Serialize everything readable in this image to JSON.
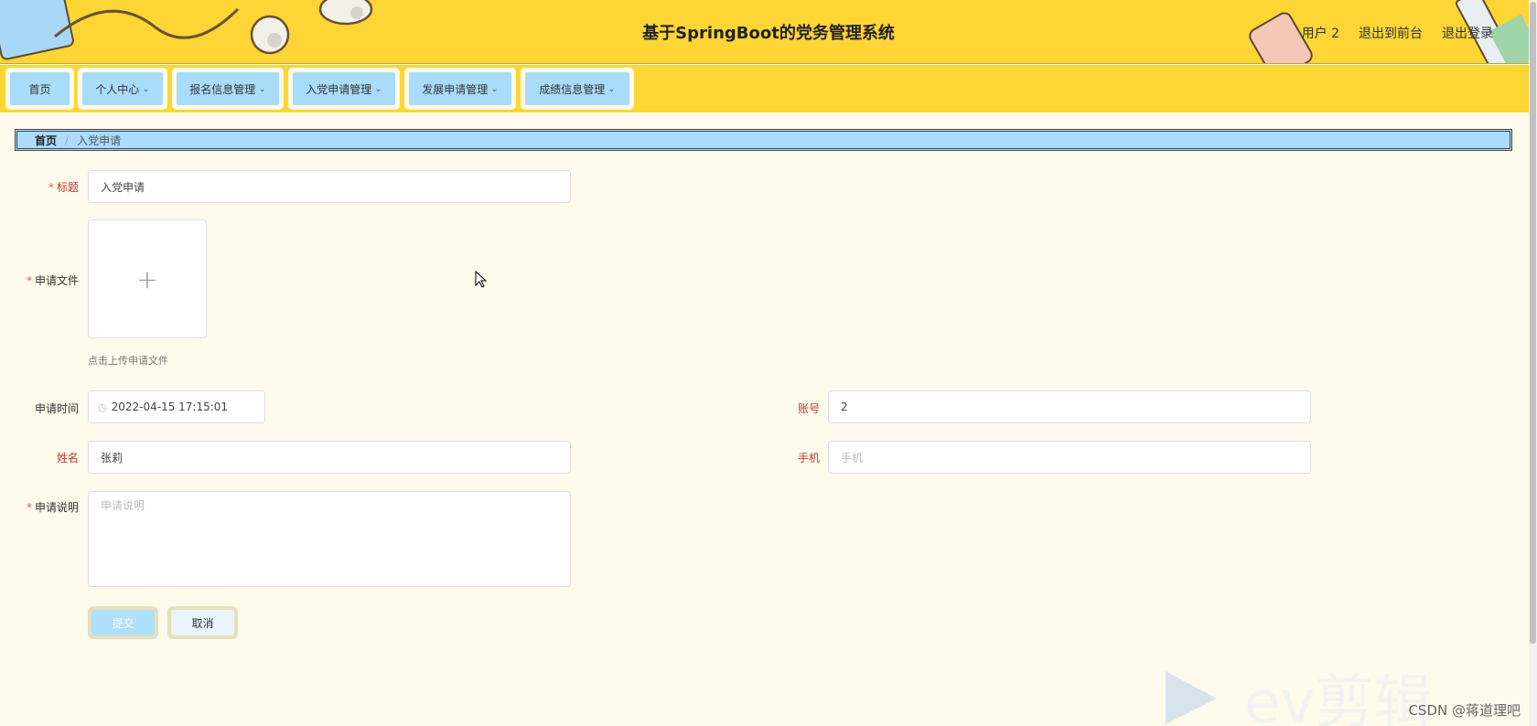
{
  "header": {
    "title": "基于SpringBoot的党务管理系统",
    "user_label": "用户 2",
    "back_to_front": "退出到前台",
    "logout": "退出登录"
  },
  "nav": {
    "items": [
      {
        "label": "首页",
        "has_dropdown": false
      },
      {
        "label": "个人中心",
        "has_dropdown": true
      },
      {
        "label": "报名信息管理",
        "has_dropdown": true
      },
      {
        "label": "入党申请管理",
        "has_dropdown": true
      },
      {
        "label": "发展申请管理",
        "has_dropdown": true
      },
      {
        "label": "成绩信息管理",
        "has_dropdown": true
      }
    ],
    "chevron": "⌄"
  },
  "breadcrumb": {
    "home": "首页",
    "separator": "/",
    "current": "入党申请"
  },
  "form": {
    "title_label": "标题",
    "title_value": "入党申请",
    "file_label": "申请文件",
    "upload_hint": "点击上传申请文件",
    "upload_icon": "+",
    "time_label": "申请时间",
    "time_value": "2022-04-15 17:15:01",
    "account_label": "账号",
    "account_value": "2",
    "name_label": "姓名",
    "name_value": "张莉",
    "phone_label": "手机",
    "phone_placeholder": "手机",
    "desc_label": "申请说明",
    "desc_placeholder": "申请说明",
    "required_mark": "*",
    "submit_label": "提交",
    "cancel_label": "取消"
  },
  "watermark": {
    "app_text": "ev剪辑",
    "credit": "CSDN @蒋道理吧"
  },
  "colors": {
    "header_bg": "#fdd535",
    "nav_button": "#a9dcfa",
    "page_bg": "#fefaec",
    "required": "#e05a4f"
  }
}
